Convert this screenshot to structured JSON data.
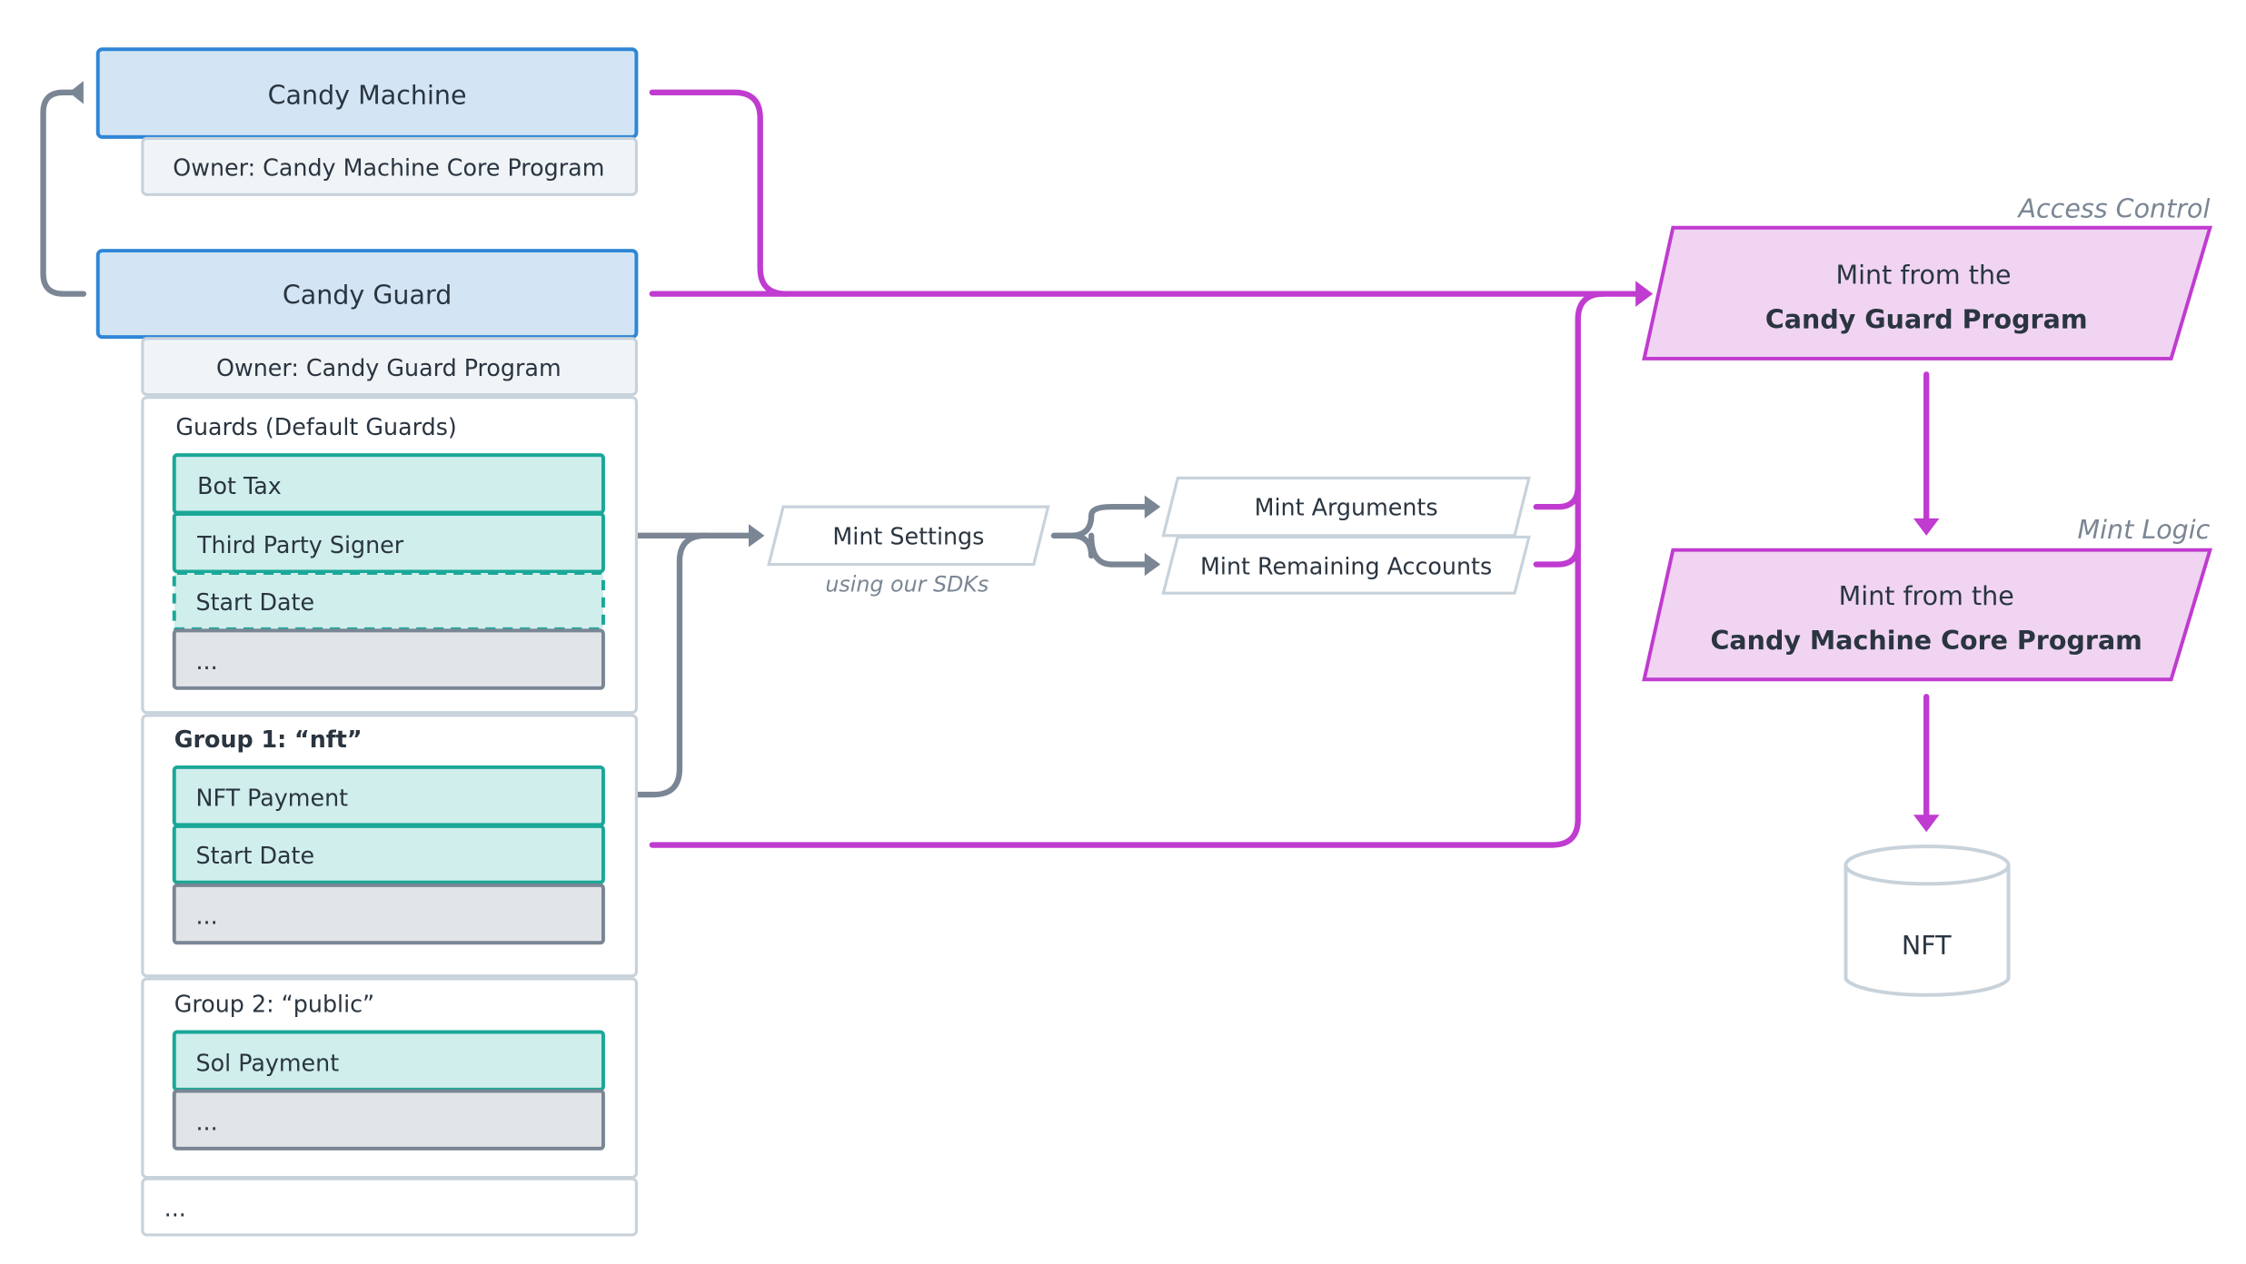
{
  "accounts": {
    "candy_machine": {
      "title": "Candy Machine",
      "owner": "Owner: Candy Machine Core Program"
    },
    "candy_guard": {
      "title": "Candy Guard",
      "owner": "Owner: Candy Guard Program"
    }
  },
  "default_guards": {
    "label": "Guards (Default Guards)",
    "items": [
      "Bot Tax",
      "Third Party Signer",
      "Start Date",
      "..."
    ]
  },
  "group1": {
    "label": "Group 1: “nft”",
    "items": [
      "NFT Payment",
      "Start Date",
      "..."
    ]
  },
  "group2": {
    "label": "Group 2: “public”",
    "items": [
      "Sol Payment",
      "..."
    ]
  },
  "more_groups": "...",
  "mint_settings": {
    "label": "Mint Settings",
    "subtitle": "using our SDKs"
  },
  "mint_arguments": "Mint Arguments",
  "mint_remaining_accounts": "Mint Remaining Accounts",
  "access_control": {
    "section_label": "Access Control",
    "line1": "Mint from the",
    "line2": "Candy Guard Program"
  },
  "mint_logic": {
    "section_label": "Mint Logic",
    "line1": "Mint from the",
    "line2": "Candy Machine Core Program"
  },
  "output": "NFT",
  "colors": {
    "account_fill": "#d3e5f5",
    "account_stroke": "#2f86d6",
    "guard_fill": "#d0eeec",
    "guard_stroke": "#1aa898",
    "program_fill": "#f0d4f2",
    "program_stroke": "#c03bd0",
    "connector_gray": "#7a8694"
  }
}
